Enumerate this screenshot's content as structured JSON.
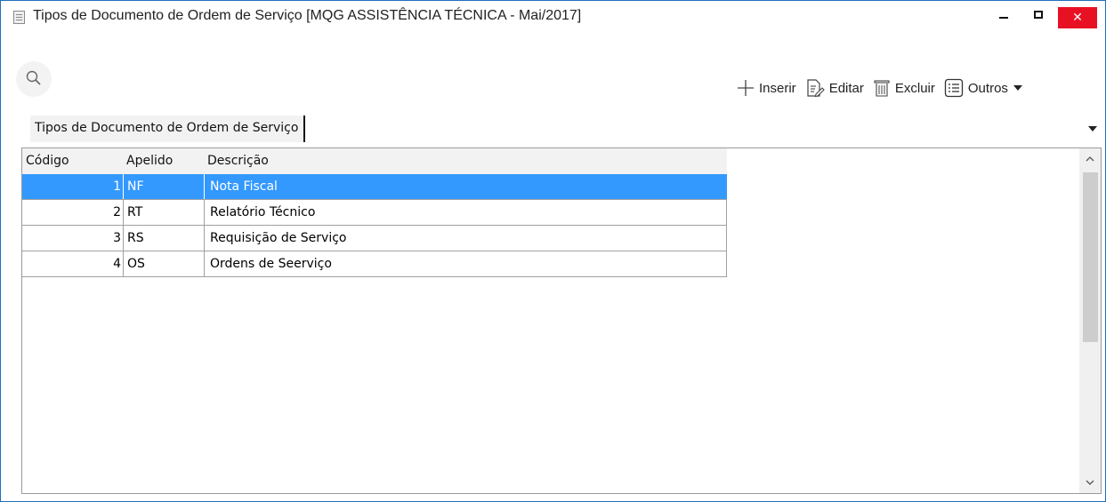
{
  "window": {
    "title": "Tipos de Documento de Ordem de Serviço [MQG ASSISTÊNCIA TÉCNICA - Mai/2017]",
    "close_glyph": "✕",
    "accent_color": "#1f6fbd",
    "close_color": "#e81123"
  },
  "toolbar": {
    "insert_label": "Inserir",
    "edit_label": "Editar",
    "delete_label": "Excluir",
    "other_label": "Outros"
  },
  "group": {
    "label": "Tipos de Documento de Ordem de Serviço"
  },
  "grid": {
    "columns": [
      "Código",
      "Apelido",
      "Descrição"
    ],
    "rows": [
      {
        "code": "1",
        "nick": "NF",
        "desc": "Nota Fiscal"
      },
      {
        "code": "2",
        "nick": "RT",
        "desc": "Relatório Técnico"
      },
      {
        "code": "3",
        "nick": "RS",
        "desc": "Requisição de Serviço"
      },
      {
        "code": "4",
        "nick": "OS",
        "desc": "Ordens de Seerviço"
      }
    ],
    "selected_row_color": "#3399ff"
  },
  "icons": {
    "search": "search-icon",
    "insert": "plus-icon",
    "edit": "edit-document-icon",
    "delete": "trash-icon",
    "other": "list-icon"
  }
}
